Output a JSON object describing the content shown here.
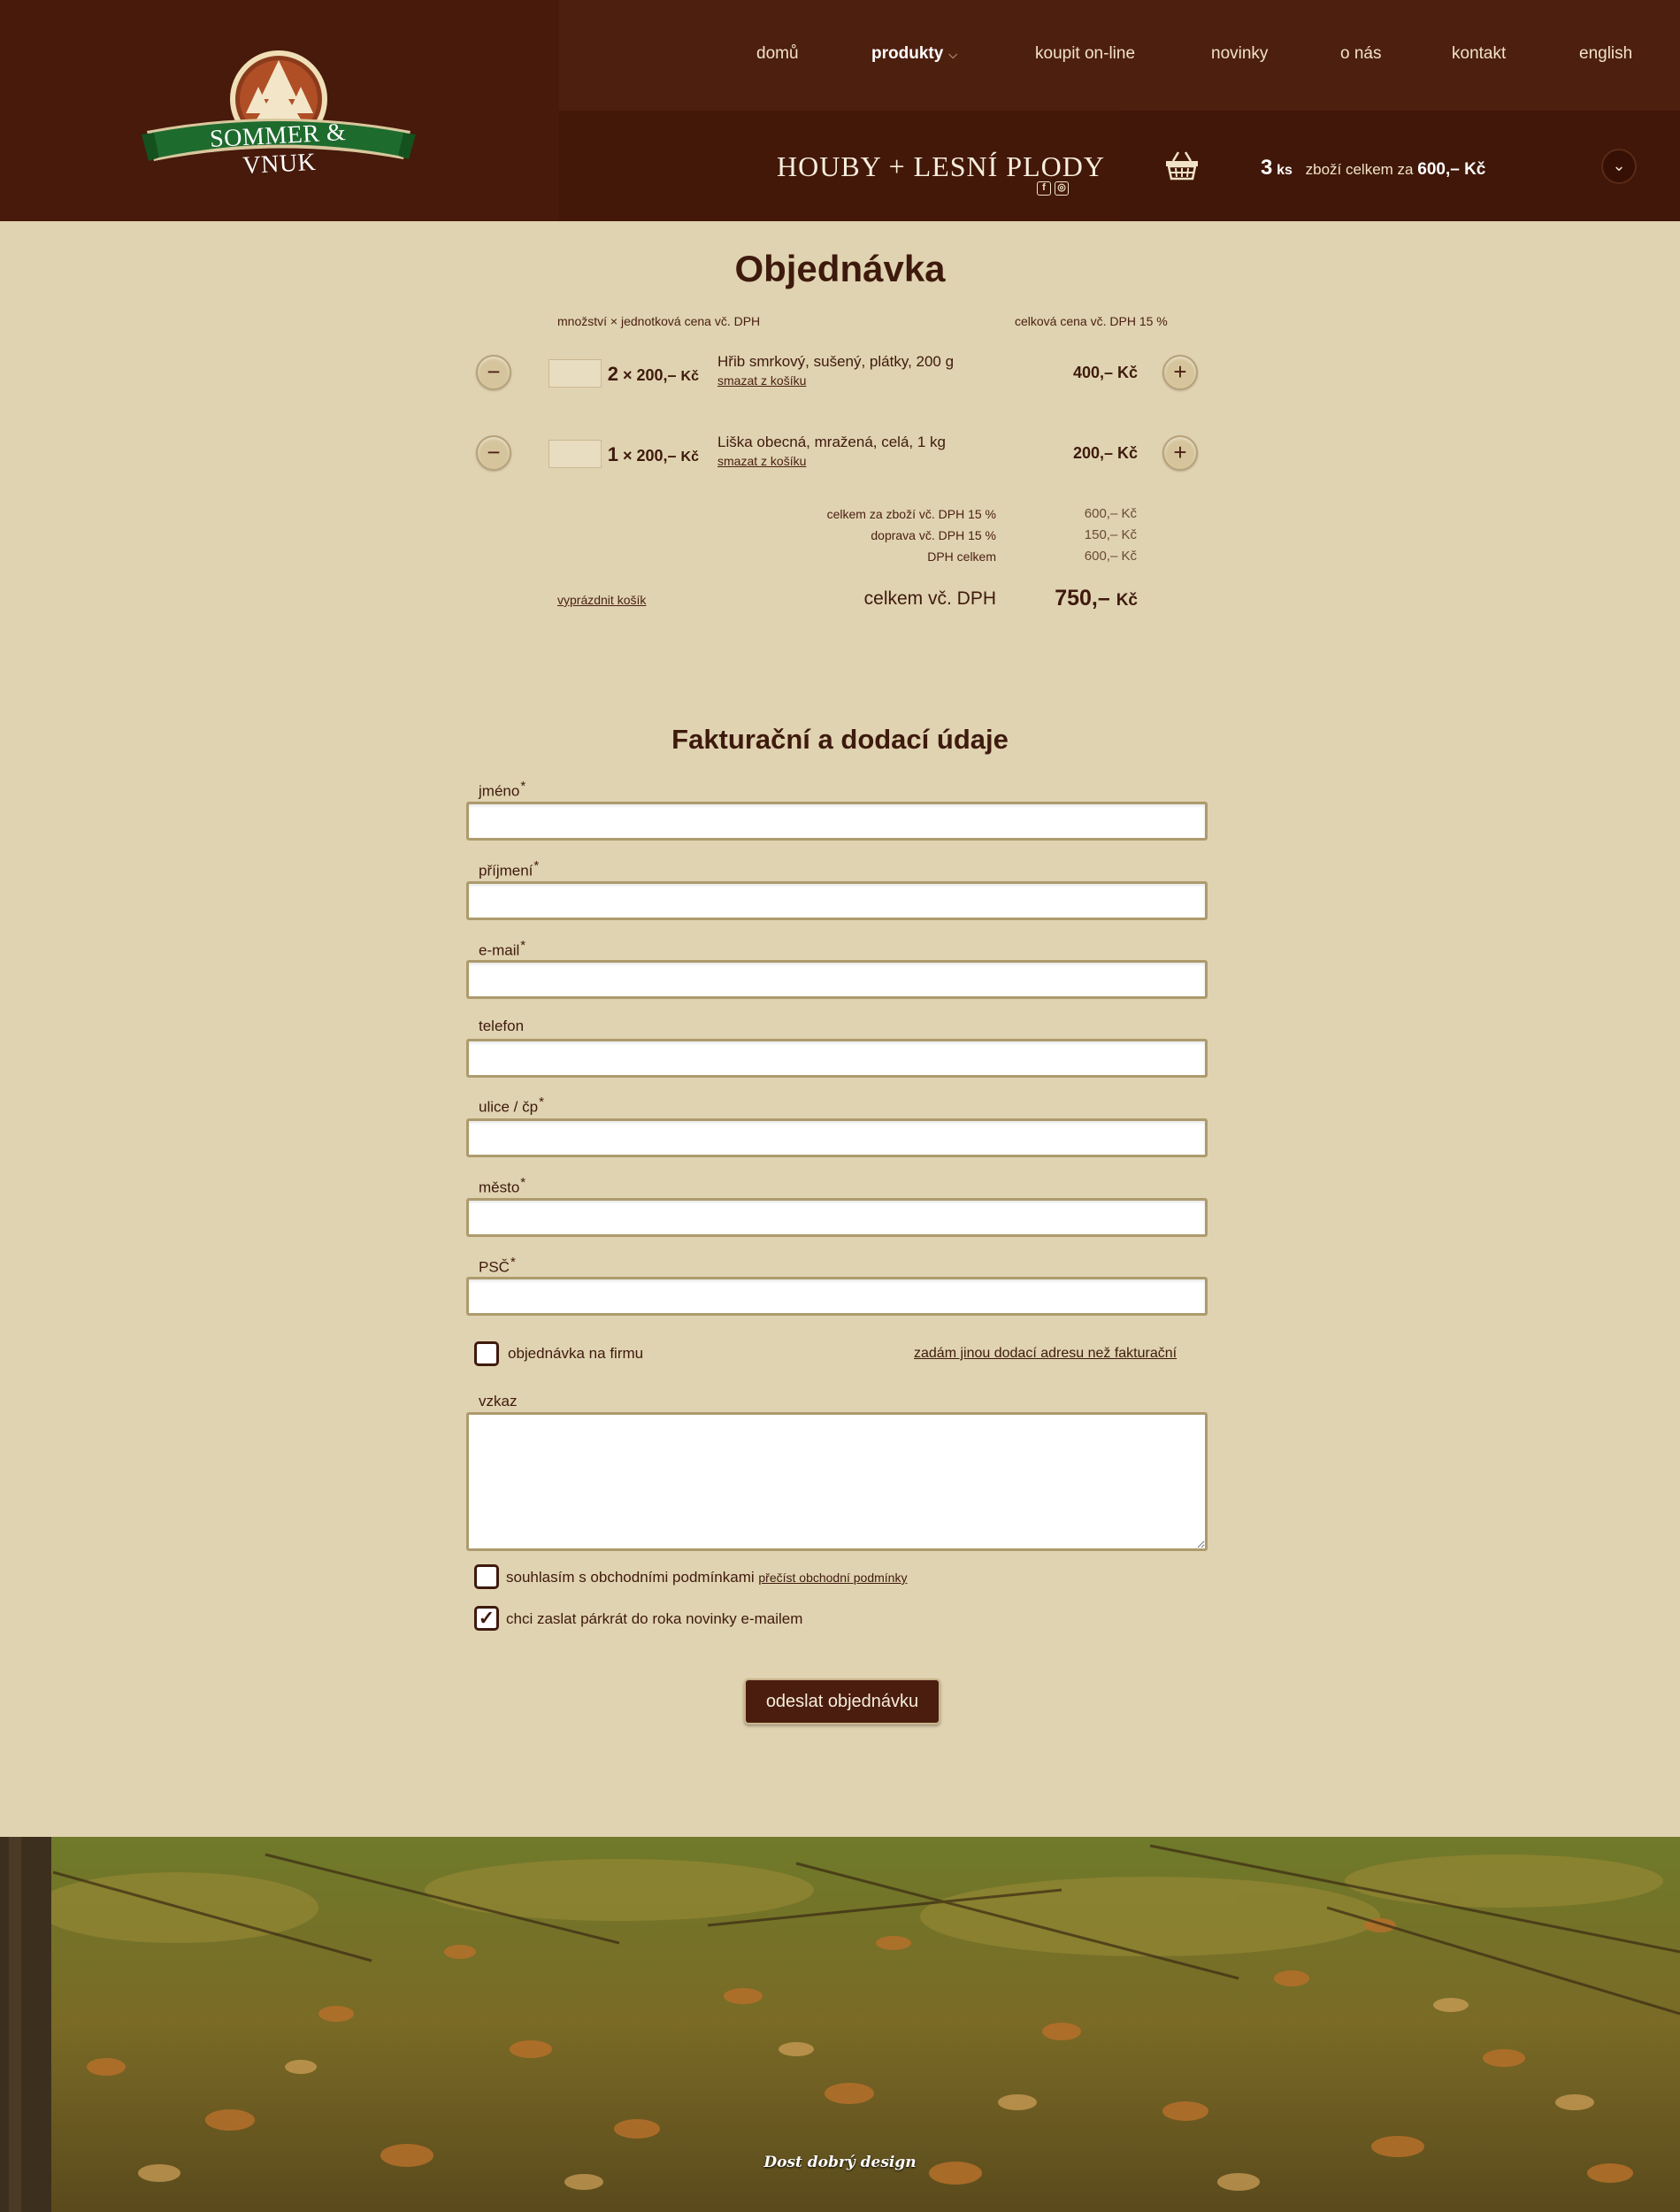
{
  "header": {
    "logo_text": "SOMMER & VNUK",
    "nav": [
      {
        "label": "domů"
      },
      {
        "label": "produkty"
      },
      {
        "label": "koupit on-line"
      },
      {
        "label": "novinky"
      },
      {
        "label": "o nás"
      },
      {
        "label": "kontakt"
      },
      {
        "label": "english"
      }
    ],
    "category_title": "HOUBY + LESNÍ PLODY",
    "social_icons": [
      "facebook-icon",
      "instagram-icon"
    ],
    "cart": {
      "count": "3",
      "unit": "ks",
      "text": "zboží celkem za",
      "price": "600,– Kč"
    }
  },
  "order": {
    "title": "Objednávka",
    "col_qty": "množství × jednotková cena vč. DPH",
    "col_total": "celková cena vč. DPH 15 %",
    "items": [
      {
        "qty": "2",
        "unit_price": "× 200,–",
        "currency": "Kč",
        "name": "Hřib smrkový, sušený, plátky, 200 g",
        "remove": "smazat z košíku",
        "total": "400,– Kč"
      },
      {
        "qty": "1",
        "unit_price": "× 200,–",
        "currency": "Kč",
        "name": "Liška obecná, mražená, celá, 1 kg",
        "remove": "smazat z košíku",
        "total": "200,– Kč"
      }
    ],
    "summary": [
      {
        "label": "celkem za zboží vč. DPH 15 %",
        "value": "600,– Kč"
      },
      {
        "label": "doprava vč. DPH 15 %",
        "value": "150,– Kč"
      },
      {
        "label": "DPH celkem",
        "value": "600,– Kč"
      }
    ],
    "empty_cart": "vyprázdnit košík",
    "total_label": "celkem vč. DPH",
    "total_value": "750,–",
    "total_currency": "Kč"
  },
  "billing": {
    "title": "Fakturační a dodací údaje",
    "fields": [
      {
        "label": "jméno",
        "required": "*",
        "value": ""
      },
      {
        "label": "příjmení",
        "required": "*",
        "value": ""
      },
      {
        "label": "e-mail",
        "required": "*",
        "value": ""
      },
      {
        "label": "telefon",
        "required": "",
        "value": ""
      },
      {
        "label": "ulice / čp",
        "required": "*",
        "value": ""
      },
      {
        "label": "město",
        "required": "*",
        "value": ""
      },
      {
        "label": "PSČ",
        "required": "*",
        "value": ""
      }
    ],
    "company_checkbox": "objednávka na firmu",
    "alt_address": "zadám jinou dodací adresu než fakturační",
    "message_label": "vzkaz",
    "terms_checkbox": "souhlasím s obchodními podmínkami",
    "terms_link": "přečíst obchodní podmínky",
    "newsletter_checkbox": "chci zaslat párkrát do roka novinky e-mailem",
    "terms_checked": false,
    "newsletter_checked": true,
    "company_checked": false,
    "submit": "odeslat objednávku"
  },
  "footer": {
    "credit": "Dost dobrý design"
  },
  "colors": {
    "header_bg": "#4a1d0e",
    "page_bg": "#e0d3b1",
    "text": "#3e1a0d",
    "logo_green": "#1e6b2e"
  }
}
